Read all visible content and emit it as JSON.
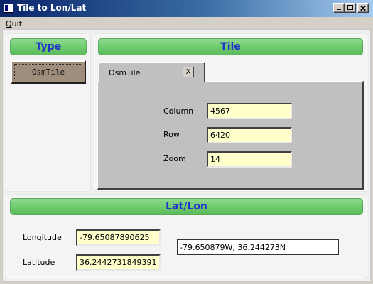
{
  "window": {
    "title": "Tile to Lon/Lat"
  },
  "menu": {
    "quit_first": "Q",
    "quit_rest": "uit"
  },
  "type_panel": {
    "header": "Type",
    "button": "OsmTile"
  },
  "tile_panel": {
    "header": "Tile",
    "tab": {
      "label": "OsmTile",
      "close": "X"
    },
    "fields": {
      "column": {
        "label": "Column",
        "value": "4567"
      },
      "row": {
        "label": "Row",
        "value": "6420"
      },
      "zoom": {
        "label": "Zoom",
        "value": "14"
      }
    }
  },
  "latlon_panel": {
    "header": "Lat/Lon",
    "longitude": {
      "label": "Longitude",
      "value": "-79.65087890625"
    },
    "latitude": {
      "label": "Latitude",
      "value": "36.2442731849391"
    },
    "combined": "-79.650879W, 36.244273N"
  },
  "icons": {
    "app": "app-window-icon",
    "minimize": "minimize-icon",
    "maximize": "maximize-icon",
    "close": "close-icon"
  },
  "colors": {
    "title_bar_start": "#0a246a",
    "title_bar_end": "#a6caf0",
    "header_green": "#6ccb6c",
    "header_text": "#2233cc",
    "field_bg": "#ffffcc",
    "type_button_bg": "#a08e7c"
  }
}
